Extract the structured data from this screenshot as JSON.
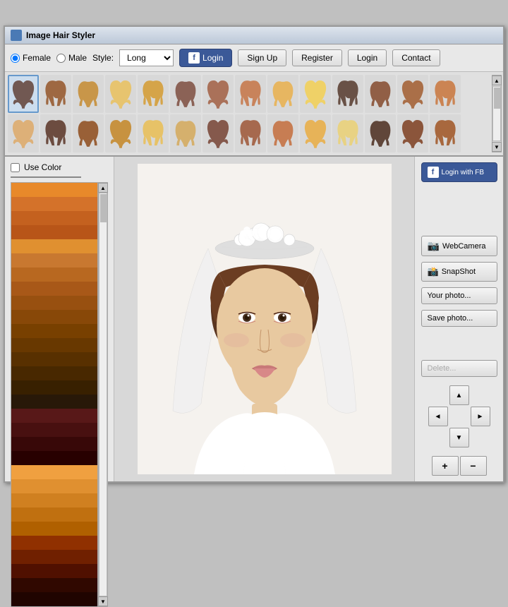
{
  "window": {
    "title": "Image Hair Styler"
  },
  "toolbar": {
    "gender_female": "Female",
    "gender_male": "Male",
    "style_label": "Style:",
    "style_value": "Long",
    "btn_fb_login": "Login",
    "btn_signup": "Sign Up",
    "btn_register": "Register",
    "btn_login": "Login",
    "btn_contact": "Contact"
  },
  "color_panel": {
    "use_color_label": "Use Color",
    "swatches": [
      "#e8892a",
      "#d4722a",
      "#c4611f",
      "#b85518",
      "#e09030",
      "#c87830",
      "#b86820",
      "#a85818",
      "#985010",
      "#884808",
      "#784000",
      "#683800",
      "#583000",
      "#482800",
      "#382000",
      "#281808",
      "#581818",
      "#481010",
      "#380808",
      "#280000"
    ]
  },
  "controls": {
    "btn_webcam": "WebCamera",
    "btn_snapshot": "SnapShot",
    "btn_your_photo": "Your photo...",
    "btn_save_photo": "Save photo...",
    "btn_delete": "Delete...",
    "arrow_up": "▲",
    "arrow_down": "▼",
    "arrow_left": "◄",
    "arrow_right": "►",
    "btn_plus": "+",
    "btn_minus": "−"
  },
  "hair_strip": {
    "rows": 2,
    "cols": 15
  }
}
